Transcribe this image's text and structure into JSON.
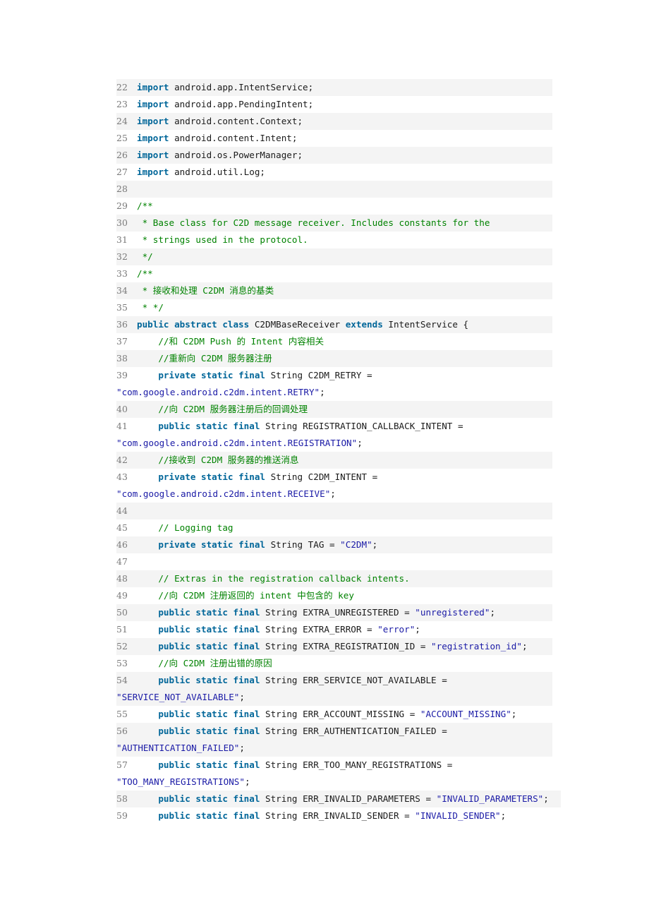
{
  "document": {
    "type": "code-listing",
    "language": "java",
    "colors": {
      "keyword": "#006699",
      "string": "#1a1aa6",
      "comment": "#008200",
      "line_number": "#7a7a7a",
      "stripe": "#f4f4f4"
    },
    "lines": [
      {
        "n": "22",
        "vlines": [
          [
            [
              "kw",
              "import"
            ],
            [
              "pl",
              " android.app.IntentService;"
            ]
          ]
        ]
      },
      {
        "n": "23",
        "vlines": [
          [
            [
              "kw",
              "import"
            ],
            [
              "pl",
              " android.app.PendingIntent;"
            ]
          ]
        ]
      },
      {
        "n": "24",
        "vlines": [
          [
            [
              "kw",
              "import"
            ],
            [
              "pl",
              " android.content.Context;"
            ]
          ]
        ]
      },
      {
        "n": "25",
        "vlines": [
          [
            [
              "kw",
              "import"
            ],
            [
              "pl",
              " android.content.Intent;"
            ]
          ]
        ]
      },
      {
        "n": "26",
        "vlines": [
          [
            [
              "kw",
              "import"
            ],
            [
              "pl",
              " android.os.PowerManager;"
            ]
          ]
        ]
      },
      {
        "n": "27",
        "vlines": [
          [
            [
              "kw",
              "import"
            ],
            [
              "pl",
              " android.util.Log;"
            ]
          ]
        ]
      },
      {
        "n": "28",
        "vlines": [
          [
            [
              "pl",
              ""
            ]
          ]
        ]
      },
      {
        "n": "29",
        "vlines": [
          [
            [
              "cm",
              "/**"
            ]
          ]
        ]
      },
      {
        "n": "30",
        "vlines": [
          [
            [
              "cm",
              " * Base class for C2D message receiver. Includes constants for the"
            ]
          ]
        ]
      },
      {
        "n": "31",
        "vlines": [
          [
            [
              "cm",
              " * strings used in the protocol."
            ]
          ]
        ]
      },
      {
        "n": "32",
        "vlines": [
          [
            [
              "cm",
              " */"
            ]
          ]
        ]
      },
      {
        "n": "33",
        "vlines": [
          [
            [
              "cm",
              "/**"
            ]
          ]
        ]
      },
      {
        "n": "34",
        "vlines": [
          [
            [
              "cm",
              " * 接收和处理 C2DM 消息的基类"
            ]
          ]
        ]
      },
      {
        "n": "35",
        "vlines": [
          [
            [
              "cm",
              " * */"
            ]
          ]
        ]
      },
      {
        "n": "36",
        "vlines": [
          [
            [
              "kw",
              "public abstract class"
            ],
            [
              "pl",
              " C2DMBaseReceiver "
            ],
            [
              "kw",
              "extends"
            ],
            [
              "pl",
              " IntentService {"
            ]
          ]
        ]
      },
      {
        "n": "37",
        "vlines": [
          [
            [
              "cm",
              "    //和 C2DM Push 的 Intent 内容相关"
            ]
          ]
        ]
      },
      {
        "n": "38",
        "vlines": [
          [
            [
              "cm",
              "    //重新向 C2DM 服务器注册"
            ]
          ]
        ]
      },
      {
        "n": "39",
        "vlines": [
          [
            [
              "pl",
              "    "
            ],
            [
              "kw",
              "private static final"
            ],
            [
              "pl",
              " String C2DM_RETRY ="
            ]
          ],
          [
            [
              "str",
              "\"com.google.android.c2dm.intent.RETRY\""
            ],
            [
              "pl",
              ";"
            ]
          ]
        ]
      },
      {
        "n": "40",
        "vlines": [
          [
            [
              "cm",
              "    //向 C2DM 服务器注册后的回调处理"
            ]
          ]
        ]
      },
      {
        "n": "41",
        "vlines": [
          [
            [
              "pl",
              "    "
            ],
            [
              "kw",
              "public static final"
            ],
            [
              "pl",
              " String REGISTRATION_CALLBACK_INTENT ="
            ]
          ],
          [
            [
              "str",
              "\"com.google.android.c2dm.intent.REGISTRATION\""
            ],
            [
              "pl",
              ";"
            ]
          ]
        ]
      },
      {
        "n": "42",
        "vlines": [
          [
            [
              "cm",
              "    //接收到 C2DM 服务器的推送消息"
            ]
          ]
        ]
      },
      {
        "n": "43",
        "vlines": [
          [
            [
              "pl",
              "    "
            ],
            [
              "kw",
              "private static final"
            ],
            [
              "pl",
              " String C2DM_INTENT ="
            ]
          ],
          [
            [
              "str",
              "\"com.google.android.c2dm.intent.RECEIVE\""
            ],
            [
              "pl",
              ";"
            ]
          ]
        ]
      },
      {
        "n": "44",
        "vlines": [
          [
            [
              "pl",
              ""
            ]
          ]
        ]
      },
      {
        "n": "45",
        "vlines": [
          [
            [
              "cm",
              "    // Logging tag"
            ]
          ]
        ]
      },
      {
        "n": "46",
        "vlines": [
          [
            [
              "pl",
              "    "
            ],
            [
              "kw",
              "private static final"
            ],
            [
              "pl",
              " String TAG = "
            ],
            [
              "str",
              "\"C2DM\""
            ],
            [
              "pl",
              ";"
            ]
          ]
        ]
      },
      {
        "n": "47",
        "vlines": [
          [
            [
              "pl",
              ""
            ]
          ]
        ]
      },
      {
        "n": "48",
        "vlines": [
          [
            [
              "cm",
              "    // Extras in the registration callback intents."
            ]
          ]
        ]
      },
      {
        "n": "49",
        "vlines": [
          [
            [
              "cm",
              "    //向 C2DM 注册返回的 intent 中包含的 key"
            ]
          ]
        ]
      },
      {
        "n": "50",
        "vlines": [
          [
            [
              "pl",
              "    "
            ],
            [
              "kw",
              "public static final"
            ],
            [
              "pl",
              " String EXTRA_UNREGISTERED = "
            ],
            [
              "str",
              "\"unregistered\""
            ],
            [
              "pl",
              ";"
            ]
          ]
        ]
      },
      {
        "n": "51",
        "vlines": [
          [
            [
              "pl",
              "    "
            ],
            [
              "kw",
              "public static final"
            ],
            [
              "pl",
              " String EXTRA_ERROR = "
            ],
            [
              "str",
              "\"error\""
            ],
            [
              "pl",
              ";"
            ]
          ]
        ]
      },
      {
        "n": "52",
        "vlines": [
          [
            [
              "pl",
              "    "
            ],
            [
              "kw",
              "public static final"
            ],
            [
              "pl",
              " String EXTRA_REGISTRATION_ID = "
            ],
            [
              "str",
              "\"registration_id\""
            ],
            [
              "pl",
              ";"
            ]
          ]
        ]
      },
      {
        "n": "53",
        "vlines": [
          [
            [
              "cm",
              "    //向 C2DM 注册出错的原因"
            ]
          ]
        ]
      },
      {
        "n": "54",
        "vlines": [
          [
            [
              "pl",
              "    "
            ],
            [
              "kw",
              "public static final"
            ],
            [
              "pl",
              " String ERR_SERVICE_NOT_AVAILABLE ="
            ]
          ],
          [
            [
              "str",
              "\"SERVICE_NOT_AVAILABLE\""
            ],
            [
              "pl",
              ";"
            ]
          ]
        ]
      },
      {
        "n": "55",
        "vlines": [
          [
            [
              "pl",
              "    "
            ],
            [
              "kw",
              "public static final"
            ],
            [
              "pl",
              " String ERR_ACCOUNT_MISSING = "
            ],
            [
              "str",
              "\"ACCOUNT_MISSING\""
            ],
            [
              "pl",
              ";"
            ]
          ]
        ]
      },
      {
        "n": "56",
        "vlines": [
          [
            [
              "pl",
              "    "
            ],
            [
              "kw",
              "public static final"
            ],
            [
              "pl",
              " String ERR_AUTHENTICATION_FAILED ="
            ]
          ],
          [
            [
              "str",
              "\"AUTHENTICATION_FAILED\""
            ],
            [
              "pl",
              ";"
            ]
          ]
        ]
      },
      {
        "n": "57",
        "vlines": [
          [
            [
              "pl",
              "    "
            ],
            [
              "kw",
              "public static final"
            ],
            [
              "pl",
              " String ERR_TOO_MANY_REGISTRATIONS ="
            ]
          ],
          [
            [
              "str",
              "\"TOO_MANY_REGISTRATIONS\""
            ],
            [
              "pl",
              ";"
            ]
          ]
        ]
      },
      {
        "n": "58",
        "vlines": [
          [
            [
              "pl",
              "    "
            ],
            [
              "kw",
              "public static final"
            ],
            [
              "pl",
              " String ERR_INVALID_PARAMETERS = "
            ],
            [
              "str",
              "\"INVALID_PARAMETERS\""
            ],
            [
              "pl",
              ";"
            ]
          ]
        ]
      },
      {
        "n": "59",
        "vlines": [
          [
            [
              "pl",
              "    "
            ],
            [
              "kw",
              "public static final"
            ],
            [
              "pl",
              " String ERR_INVALID_SENDER = "
            ],
            [
              "str",
              "\"INVALID_SENDER\""
            ],
            [
              "pl",
              ";"
            ]
          ]
        ]
      }
    ]
  }
}
